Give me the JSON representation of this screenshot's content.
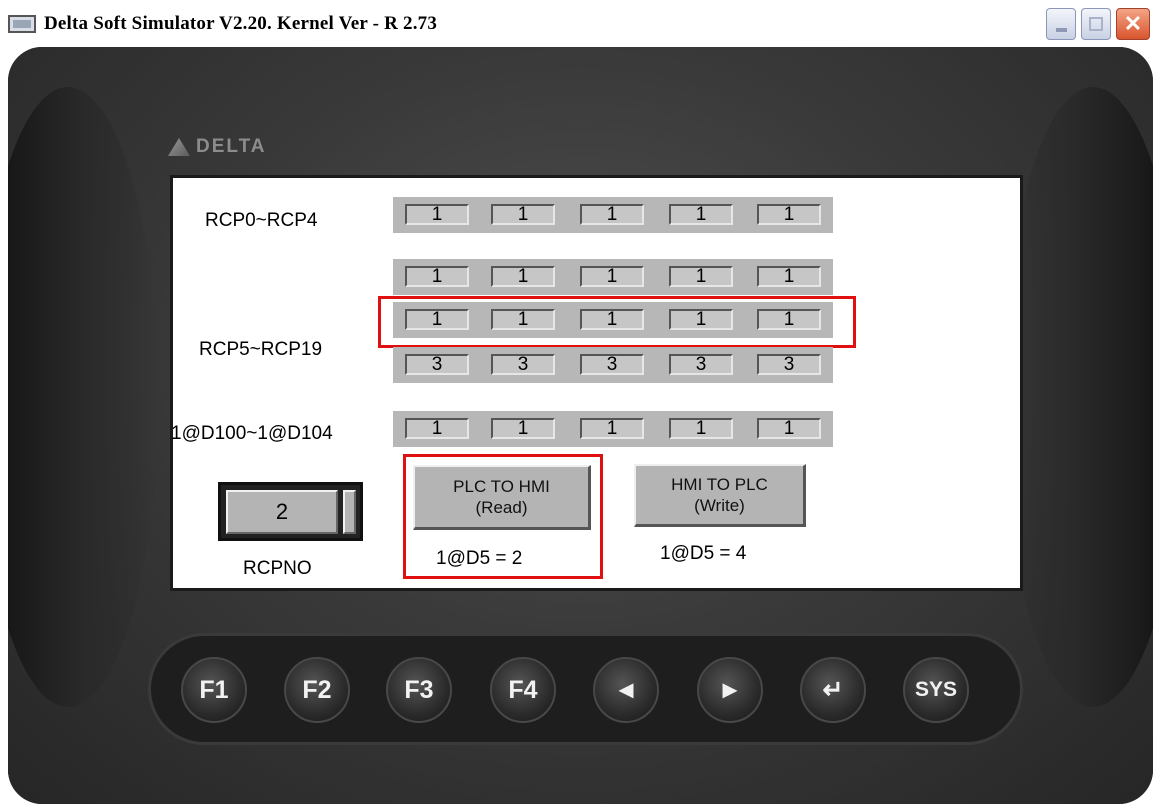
{
  "window": {
    "title": "Delta Soft Simulator V2.20. Kernel Ver - R 2.73",
    "controls": {
      "minimize": "_",
      "maximize": "□",
      "close": "✕"
    }
  },
  "device": {
    "brand": "DELTA"
  },
  "screen": {
    "row_labels": {
      "rcp0_4": "RCP0~RCP4",
      "rcp5_19": "RCP5~RCP19",
      "d100_104": "1@D100~1@D104",
      "rcpno": "RCPNO"
    },
    "rcp0_4": [
      "1",
      "1",
      "1",
      "1",
      "1"
    ],
    "rcp5_9": [
      "1",
      "1",
      "1",
      "1",
      "1"
    ],
    "rcp10_14": [
      "1",
      "1",
      "1",
      "1",
      "1"
    ],
    "rcp15_19": [
      "3",
      "3",
      "3",
      "3",
      "3"
    ],
    "d100_104": [
      "1",
      "1",
      "1",
      "1",
      "1"
    ],
    "rcpno_value": "2",
    "read_button": {
      "line1": "PLC TO HMI",
      "line2": "(Read)"
    },
    "write_button": {
      "line1": "HMI TO PLC",
      "line2": "(Write)"
    },
    "read_status": "1@D5 = 2",
    "write_status": "1@D5 = 4"
  },
  "function_keys": [
    "F1",
    "F2",
    "F3",
    "F4",
    "◄",
    "►",
    "↵",
    "SYS"
  ],
  "colors": {
    "highlight": "#e01010",
    "led": "#d8e000"
  }
}
